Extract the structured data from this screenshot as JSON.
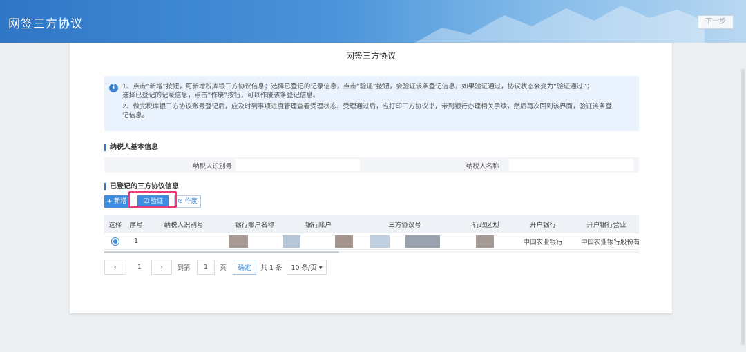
{
  "header": {
    "title": "网签三方协议",
    "next_label": "下一步"
  },
  "page": {
    "title": "网签三方协议"
  },
  "notice": {
    "line1": "1、点击“新增”按钮，可新增税库银三方协议信息；选择已登记的记录信息，点击“验证”按钮，会验证该条登记信息，如果验证通过，协议状态会变为“验证通过”；",
    "line2": "选择已登记的记录信息，点击“作废”按钮，可以作废该条登记信息。",
    "line3": "2、做完税库银三方协议账号登记后，应及时到事项进度管理查看受理状态，受理通过后，应打印三方协议书，带到银行办理相关手续，然后再次回到该界面，验证该条登",
    "line4": "记信息。"
  },
  "taxpayer_section": {
    "title": "纳税人基本信息",
    "id_label": "纳税人识别号",
    "name_label": "纳税人名称"
  },
  "agreements_section": {
    "title": "已登记的三方协议信息",
    "add_label": "+ 新增",
    "verify_label": "☑ 验证",
    "void_label": "⊘ 作废"
  },
  "table": {
    "headers": [
      "选择",
      "序号",
      "纳税人识别号",
      "银行账户名称",
      "银行账户",
      "三方协议号",
      "行政区划",
      "开户银行",
      "开户银行营业"
    ],
    "rows": [
      {
        "index": "1",
        "bank": "中国农业银行",
        "branch": "中国农业银行股份有"
      }
    ]
  },
  "pager": {
    "prev": "‹",
    "page": "1",
    "next": "›",
    "goto_label": "到第",
    "goto_value": "1",
    "page_unit": "页",
    "confirm_label": "确定",
    "total": "共 1 条",
    "page_size": "10 条/页 ▾"
  }
}
